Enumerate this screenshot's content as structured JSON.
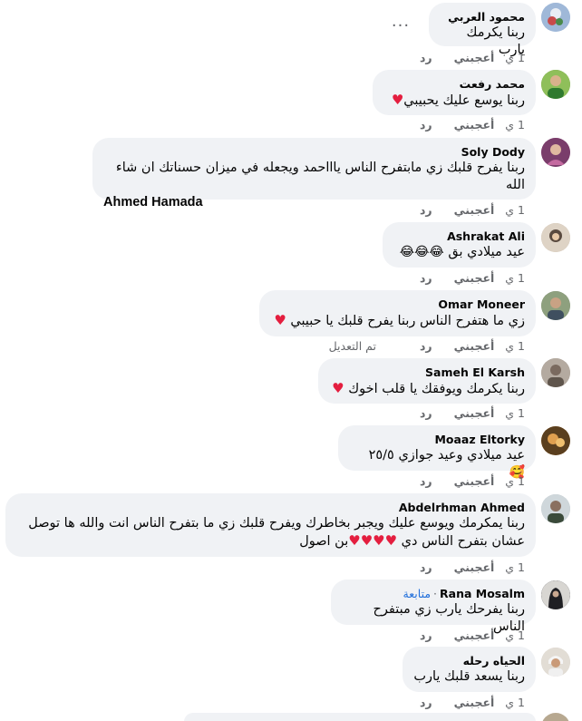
{
  "comments": [
    {
      "author": "محمود العربي",
      "text": "ربنا يكرمك يارب",
      "time": "1 ي",
      "like": "أعجبني",
      "reply": "رد",
      "avatar_color": "#9fb8d8"
    },
    {
      "author": "محمد رفعت",
      "text": "ربنا يوسع عليك يحبيبي",
      "time": "1 ي",
      "like": "أعجبني",
      "reply": "رد",
      "avatar_color": "#6d9a3c"
    },
    {
      "author": "Soly Dody",
      "text": "ربنا يفرح قلبك زي مابتفرح الناس ياااحمد ويجعله في ميزان حسناتك ان شاء الله",
      "mention": "Ahmed Hamada",
      "time": "1 ي",
      "like": "أعجبني",
      "reply": "رد",
      "avatar_color": "#8a4a7a"
    },
    {
      "author": "Ashrakat Ali",
      "text": "عيد ميلادي بق",
      "time": "1 ي",
      "like": "أعجبني",
      "reply": "رد",
      "avatar_color": "#c9b9a6"
    },
    {
      "author": "Omar Moneer",
      "text": "زي ما هتفرح الناس ربنا يفرح قلبك يا حبيبي",
      "time": "1 ي",
      "like": "أعجبني",
      "reply": "رد",
      "edited": "تم التعديل",
      "avatar_color": "#7e8b72"
    },
    {
      "author": "Sameh El Karsh",
      "text": "ربنا يكرمك ويوفقك يا قلب اخوك",
      "time": "1 ي",
      "like": "أعجبني",
      "reply": "رد",
      "avatar_color": "#a59a8f"
    },
    {
      "author": "Moaaz Eltorky",
      "text": "عيد ميلادي وعيد جوازي ٢٥/٥",
      "time": "1 ي",
      "like": "أعجبني",
      "reply": "رد",
      "avatar_color": "#b07a3a"
    },
    {
      "author": "Abdelrhman Ahmed",
      "text_line1": "ربنا يمكرمك ويوسع عليك ويجبر بخاطرك ويفرح قلبك زي ما بتفرح الناس انت والله ها توصل",
      "text_line2_a": "عشان بتفرح الناس دي",
      "text_line2_b": "بن اصول",
      "time": "1 ي",
      "like": "أعجبني",
      "reply": "رد",
      "avatar_color": "#b9c3c7"
    },
    {
      "author": "Rana Mosalm",
      "follow": "متابعة",
      "text": "ربنا يفرحك يارب زي مبتفرح الناس",
      "time": "1 ي",
      "like": "أعجبني",
      "reply": "رد",
      "avatar_color": "#2f2f33"
    },
    {
      "author": "الحياه رحله",
      "text": "ربنا يسعد قلبك يارب",
      "time": "1 ي",
      "like": "أعجبني",
      "reply": "رد",
      "avatar_color": "#d6cfc6"
    }
  ],
  "more_label": "···",
  "icons": {
    "heart": "red-heart-icon",
    "laugh": "laughing-face-icon",
    "love": "smiling-hearts-icon"
  }
}
